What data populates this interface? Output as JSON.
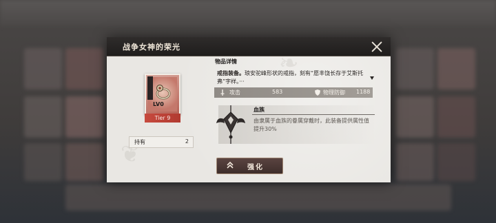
{
  "dialog": {
    "title": "战争女神的荣光",
    "close_icon": "close-icon"
  },
  "item": {
    "level_badge": "LV0",
    "tier": "Tier 9",
    "own_label": "持有",
    "own_count": "2",
    "frame_color": "#c47466",
    "tier_color": "#c2463a"
  },
  "details": {
    "section_title": "物品详情",
    "desc_bold": "戒指装备。",
    "desc_text": "琅安驼峰形状的戒指，刻有“愿丰饶长存于艾斯托弗”字样。···",
    "stats": [
      {
        "icon": "sword-icon",
        "label": "攻击",
        "value": "583"
      },
      {
        "icon": "shield-icon",
        "label": "物理防御",
        "value": "1188"
      }
    ]
  },
  "bloodline": {
    "title": "血族",
    "description": "由隶属于血族的眷属穿戴时，此装备提供属性值提升30%",
    "icon": "bloodline-emblem-icon"
  },
  "actions": {
    "enhance_label": "强化",
    "enhance_icon": "double-chevron-up-icon"
  }
}
